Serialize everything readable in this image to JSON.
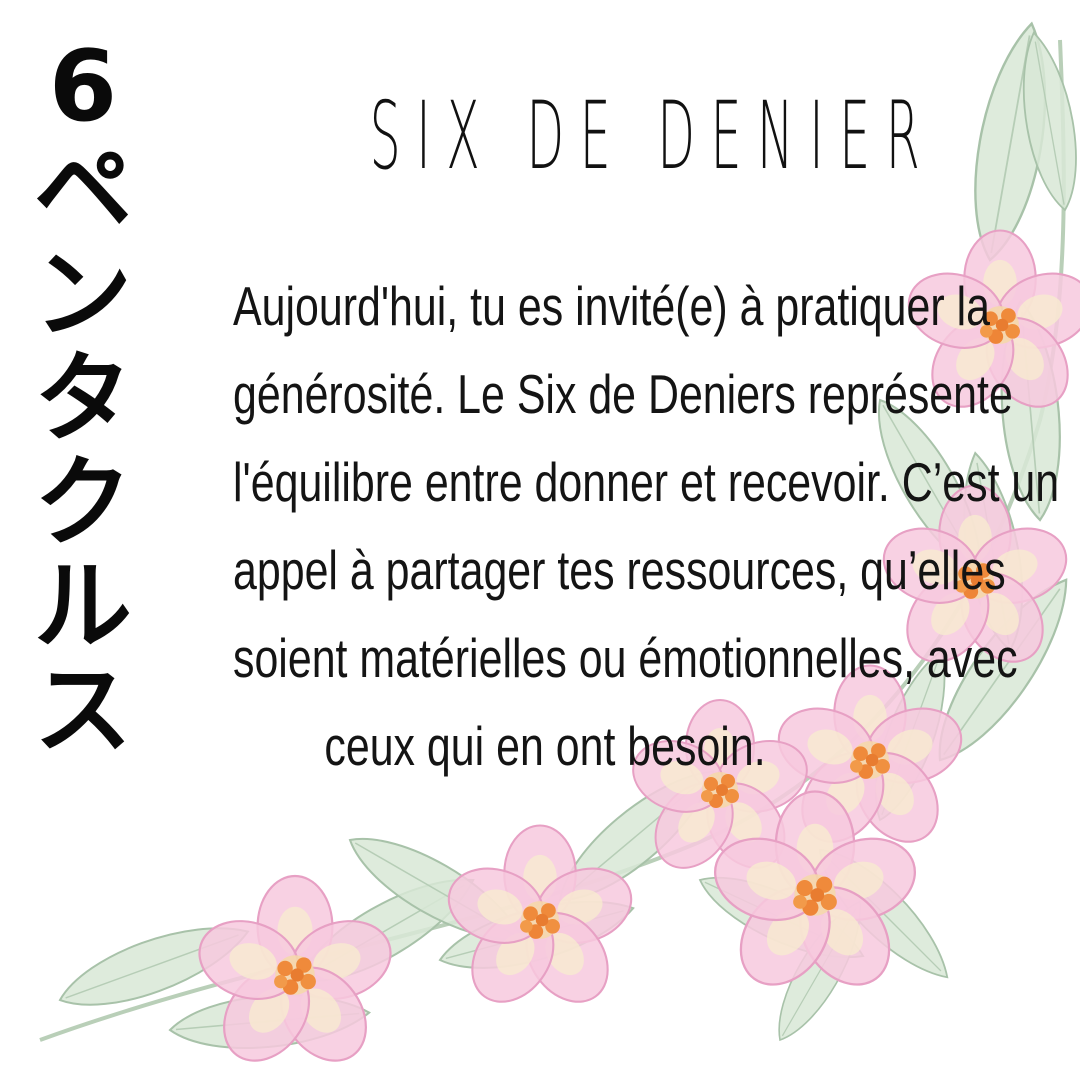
{
  "vertical_title": [
    "6",
    "ペ",
    "ン",
    "タ",
    "ク",
    "ル",
    "ス"
  ],
  "title": "SIX DE DENIER",
  "body_lines": [
    "Aujourd'hui, tu es invité(e) à pratiquer la",
    "générosité. Le Six de Deniers représente",
    "l'équilibre entre donner et recevoir. C’est un",
    "appel à partager tes ressources, qu’elles",
    "soient matérielles ou émotionnelles, avec",
    "ceux qui en ont besoin."
  ],
  "decoration": {
    "flower_color": "#f6c6dc",
    "flower_edge": "#e9a2c6",
    "flower_center": "#f08a3c",
    "leaf_color": "#d6e6d4",
    "leaf_edge": "#a9c3aa"
  }
}
